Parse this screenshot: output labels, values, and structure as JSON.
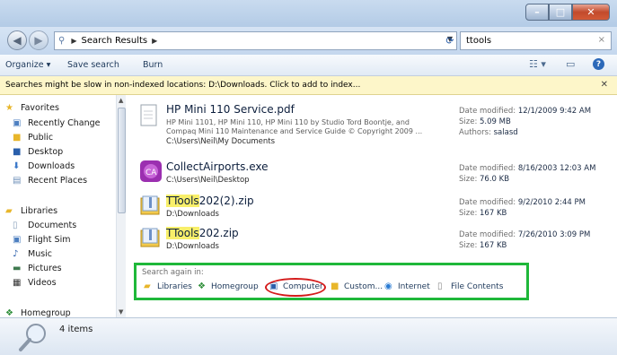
{
  "window": {
    "minimize_glyph": "–",
    "maximize_glyph": "□",
    "close_glyph": "✕"
  },
  "address": {
    "breadcrumb": "Search Results",
    "search_value": "ttools"
  },
  "toolbar": {
    "organize": "Organize ▾",
    "save_search": "Save search",
    "burn": "Burn"
  },
  "infobar": {
    "text": "Searches might be slow in non-indexed locations: D:\\Downloads. Click to add to index..."
  },
  "nav": {
    "favorites": "Favorites",
    "recently_changed": "Recently Change",
    "public": "Public",
    "desktop": "Desktop",
    "downloads": "Downloads",
    "recent_places": "Recent Places",
    "libraries": "Libraries",
    "documents": "Documents",
    "flight_sim": "Flight Sim",
    "music": "Music",
    "pictures": "Pictures",
    "videos": "Videos",
    "homegroup": "Homegroup"
  },
  "results": [
    {
      "name": "HP Mini 110 Service.pdf",
      "line1": "HP Mini 1101, HP Mini 110, HP Mini 110 by Studio Tord Boontje, and",
      "line2": "Compaq Mini 110 Maintenance and Service Guide © Copyright 2009 ...",
      "path": "C:\\Users\\Neil\\My Documents",
      "modified_label": "Date modified:",
      "modified": "12/1/2009 9:42 AM",
      "size_label": "Size:",
      "size": "5.09 MB",
      "authors_label": "Authors:",
      "authors": "salasd"
    },
    {
      "name": "CollectAirports.exe",
      "path": "C:\\Users\\Neil\\Desktop",
      "modified_label": "Date modified:",
      "modified": "8/16/2003 12:03 AM",
      "size_label": "Size:",
      "size": "76.0 KB"
    },
    {
      "name_hl": "TTools",
      "name_rest": "202(2).zip",
      "path": "D:\\Downloads",
      "modified_label": "Date modified:",
      "modified": "9/2/2010 2:44 PM",
      "size_label": "Size:",
      "size": "167 KB"
    },
    {
      "name_hl": "TTools",
      "name_rest": "202.zip",
      "path": "D:\\Downloads",
      "modified_label": "Date modified:",
      "modified": "7/26/2010 3:09 PM",
      "size_label": "Size:",
      "size": "167 KB"
    }
  ],
  "search_again": {
    "label": "Search again in:",
    "libraries": "Libraries",
    "homegroup": "Homegroup",
    "computer": "Computer",
    "custom": "Custom...",
    "internet": "Internet",
    "file_contents": "File Contents"
  },
  "details": {
    "count": "4 items"
  },
  "colors": {
    "highlight_box": "#1fb83a",
    "annotation_circle": "#d41b1b",
    "search_highlight": "#f8ef6a"
  }
}
